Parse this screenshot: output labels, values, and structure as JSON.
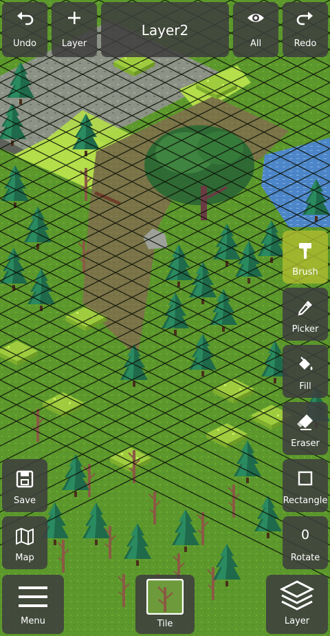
{
  "toolbar": {
    "undo_label": "Undo",
    "add_layer_label": "Layer",
    "layer_name": "Layer2",
    "visibility_label": "All",
    "redo_label": "Redo"
  },
  "tools": {
    "brush_label": "Brush",
    "picker_label": "Picker",
    "fill_label": "Fill",
    "eraser_label": "Eraser",
    "rectangle_label": "Rectangle",
    "rotate_label": "Rotate",
    "rotate_value": "0",
    "active_tool": "Brush"
  },
  "left_actions": {
    "save_label": "Save",
    "map_label": "Map"
  },
  "bottom_bar": {
    "menu_label": "Menu",
    "tile_label": "Tile",
    "layer_label": "Layer"
  },
  "colors": {
    "panel": "#3e3e3e",
    "active_tool": "#b2be30",
    "grass": "#5d9a2d",
    "grass_light": "#b6e04c",
    "dirt": "#7b7448",
    "rock": "#8e918a",
    "water": "#4d86c8",
    "pine": "#1f6b4a",
    "grid_line": "#0c1208"
  },
  "icons": {
    "undo": "undo-icon",
    "add_layer": "plus-icon",
    "visibility": "eye-icon",
    "redo": "redo-icon",
    "brush": "paint-roller-icon",
    "picker": "eyedropper-icon",
    "fill": "paint-bucket-icon",
    "eraser": "eraser-icon",
    "rectangle": "square-outline-icon",
    "save": "floppy-disk-icon",
    "map": "folded-map-icon",
    "menu": "hamburger-icon",
    "tile": "tile-preview-icon",
    "layer": "stacked-layers-icon"
  }
}
